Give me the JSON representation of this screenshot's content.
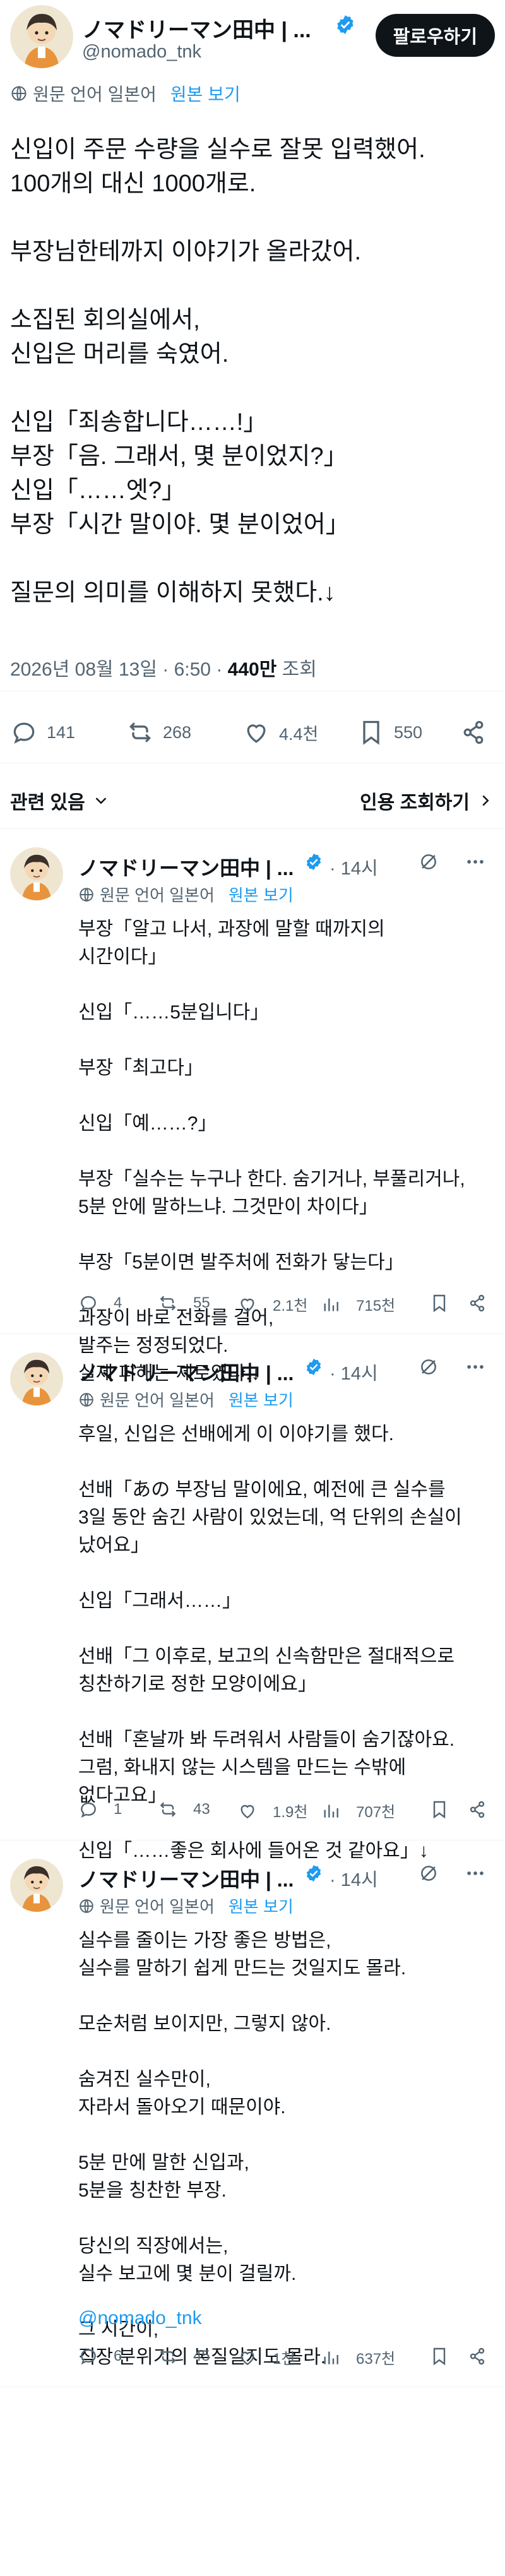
{
  "colors": {
    "accent": "#1d9bf0",
    "text": "#0f1419",
    "muted": "#536471",
    "follow_bg": "#0f1419"
  },
  "author": {
    "name": "ノマドリーマン田中 | ...",
    "handle": "@nomado_tnk",
    "follow_label": "팔로우하기",
    "verified_icon": "verified-badge-icon"
  },
  "translate": {
    "original_lang": "원문 언어 일본어",
    "show_original": "원본 보기"
  },
  "main_tweet": {
    "body": "신입이 주문 수량을 실수로 잘못 입력했어.\n100개의 대신 1000개로.\n\n부장님한테까지 이야기가 올라갔어.\n\n소집된 회의실에서,\n신입은 머리를 숙였어.\n\n신입「죄송합니다……!」\n부장「음. 그래서, 몇 분이었지?」\n신입「……엣?」\n부장「시간 말이야. 몇 분이었어」\n\n질문의 의미를 이해하지 못했다.↓",
    "date": "2026년 08월 13일 · 6:50 · ",
    "views": "440만",
    "views_label": " 조회",
    "replies": "141",
    "reposts": "268",
    "likes": "4.4천",
    "bookmarks": "550"
  },
  "section": {
    "related_label": "관련 있음",
    "quotes_label": "인용 조회하기"
  },
  "replies": [
    {
      "name": "ノマドリーマン田中 | ...",
      "time": "14시",
      "body": "부장「알고 나서, 과장에 말할 때까지의\n시간이다」\n\n신입「……5분입니다」\n\n부장「최고다」\n\n신입「예……?」\n\n부장「실수는 누구나 한다. 숨기거나, 부풀리거나,\n5분 안에 말하느냐. 그것만이 차이다」\n\n부장「5분이면 발주처에 전화가 닿는다」\n\n과장이 바로 전화를 걸어,\n발주는 정정되었다.\n실제 피해는 제로였다.↓",
      "replies": "4",
      "reposts": "55",
      "likes": "2.1천",
      "views": "715천"
    },
    {
      "name": "ノマドリーマン田中 | ...",
      "time": "14시",
      "body": "후일, 신입은 선배에게 이 이야기를 했다.\n\n선배「あの 부장님 말이에요, 예전에 큰 실수를\n3일 동안 숨긴 사람이 있었는데, 억 단위의 손실이\n났어요」\n\n신입「그래서……」\n\n선배「그 이후로, 보고의 신속함만은 절대적으로\n칭찬하기로 정한 모양이에요」\n\n선배「혼날까 봐 두려워서 사람들이 숨기잖아요.\n그럼, 화내지 않는 시스템을 만드는 수밖에\n없다고요」\n\n신입「……좋은 회사에 들어온 것 같아요」↓",
      "replies": "1",
      "reposts": "43",
      "likes": "1.9천",
      "views": "707천"
    },
    {
      "name": "ノマドリーマン田中 | ...",
      "time": "14시",
      "body": "실수를 줄이는 가장 좋은 방법은,\n실수를 말하기 쉽게 만드는 것일지도 몰라.\n\n모순처럼 보이지만, 그렇지 않아.\n\n숨겨진 실수만이,\n자라서 돌아오기 때문이야.\n\n5분 만에 말한 신입과,\n5분을 칭찬한 부장.\n\n당신의 직장에서는,\n실수 보고에 몇 분이 걸릴까.\n\n그 시간이,\n직장 분위기의 본질일지도 몰라.",
      "mention": "@nomado_tnk",
      "replies": "6",
      "reposts": "45",
      "likes": "1천",
      "views": "637천"
    }
  ]
}
